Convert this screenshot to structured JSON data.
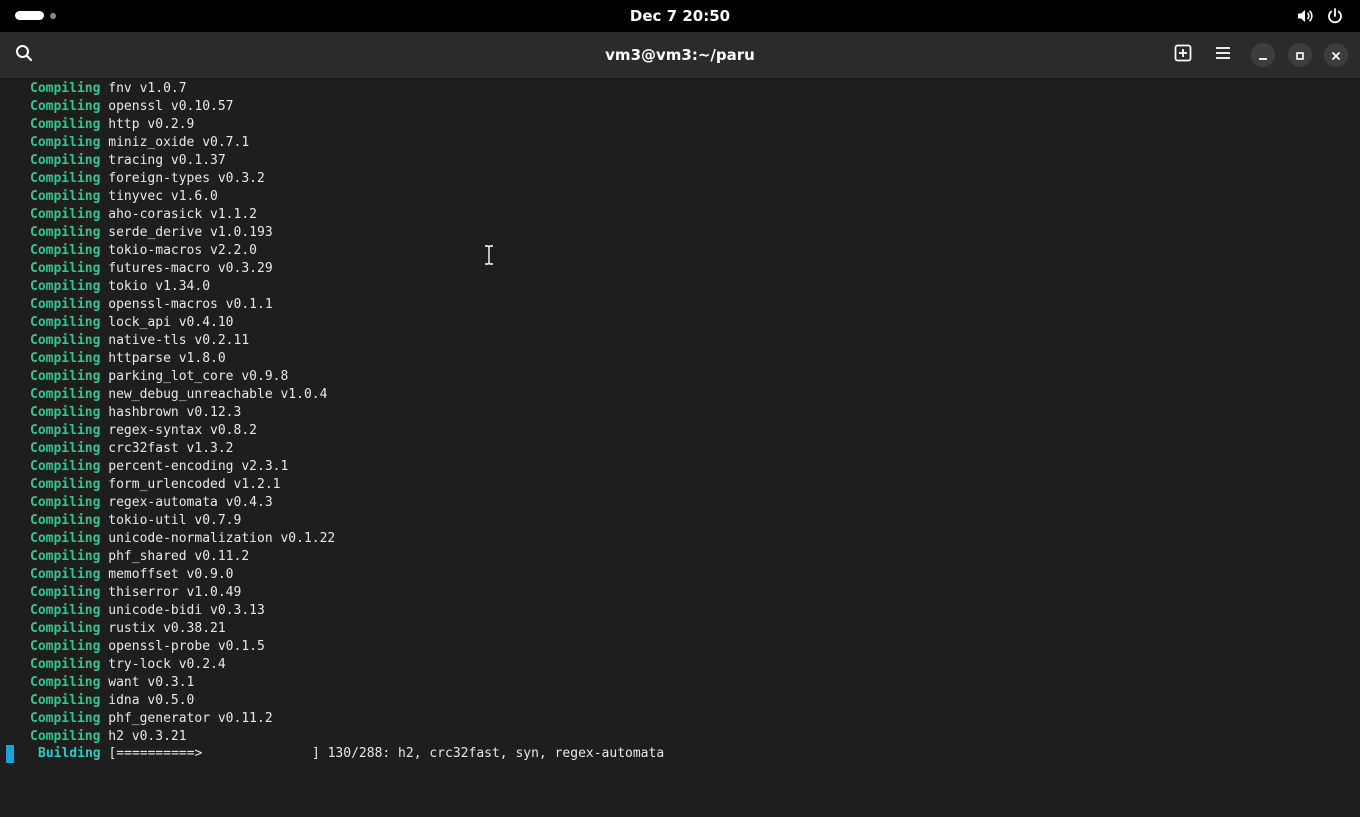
{
  "topbar": {
    "clock": "Dec 7  20:50",
    "icons": [
      "activities-indicator",
      "volume-icon",
      "power-icon"
    ]
  },
  "window": {
    "title": "vm3@vm3:~/paru",
    "buttons": [
      "search-icon",
      "new-tab-icon",
      "menu-icon",
      "minimize-icon",
      "maximize-icon",
      "close-icon"
    ]
  },
  "terminal": {
    "keyword": "Compiling",
    "lines": [
      "fnv v1.0.7",
      "openssl v0.10.57",
      "http v0.2.9",
      "miniz_oxide v0.7.1",
      "tracing v0.1.37",
      "foreign-types v0.3.2",
      "tinyvec v1.6.0",
      "aho-corasick v1.1.2",
      "serde_derive v1.0.193",
      "tokio-macros v2.2.0",
      "futures-macro v0.3.29",
      "tokio v1.34.0",
      "openssl-macros v0.1.1",
      "lock_api v0.4.10",
      "native-tls v0.2.11",
      "httparse v1.8.0",
      "parking_lot_core v0.9.8",
      "new_debug_unreachable v1.0.4",
      "hashbrown v0.12.3",
      "regex-syntax v0.8.2",
      "crc32fast v1.3.2",
      "percent-encoding v2.3.1",
      "form_urlencoded v1.2.1",
      "regex-automata v0.4.3",
      "tokio-util v0.7.9",
      "unicode-normalization v0.1.22",
      "phf_shared v0.11.2",
      "memoffset v0.9.0",
      "thiserror v1.0.49",
      "unicode-bidi v0.3.13",
      "rustix v0.38.21",
      "openssl-probe v0.1.5",
      "try-lock v0.2.4",
      "want v0.3.1",
      "idna v0.5.0",
      "phf_generator v0.11.2",
      "h2 v0.3.21"
    ],
    "build": {
      "keyword": "Building",
      "bar": "[==========>              ]",
      "status": "130/288: h2, crc32fast, syn, regex-automata",
      "progress_done": 130,
      "progress_total": 288
    }
  },
  "colors": {
    "keyword": "#33c78a",
    "building": "#33c7c7",
    "cursor": "#1aa3d6",
    "background": "#1e1e1e",
    "headerbar": "#2b2b2b"
  }
}
